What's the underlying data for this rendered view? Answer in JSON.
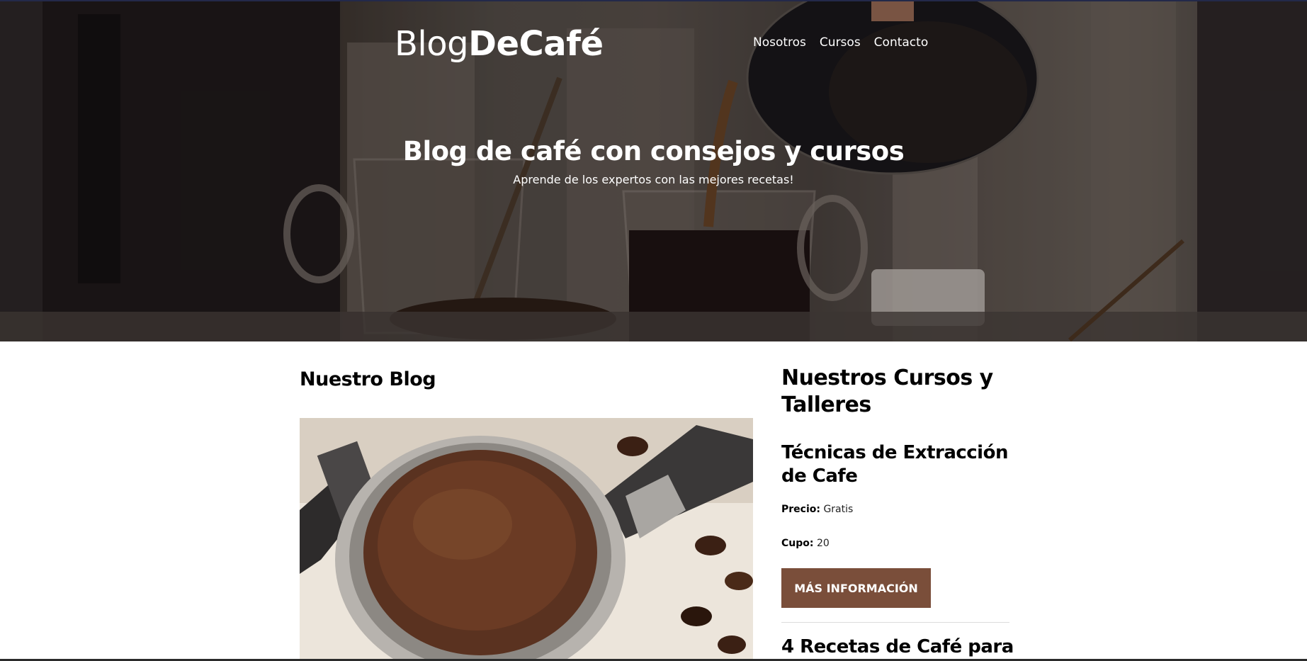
{
  "header": {
    "logo_light": "Blog",
    "logo_bold": "DeCafé",
    "nav": [
      "Nosotros",
      "Cursos",
      "Contacto"
    ]
  },
  "hero": {
    "title": "Blog de café con consejos y cursos",
    "subtitle": "Aprende de los expertos con las mejores recetas!"
  },
  "blog": {
    "title": "Nuestro Blog"
  },
  "courses": {
    "title": "Nuestros Cursos y Talleres",
    "items": [
      {
        "name": "Técnicas de Extracción de Cafe",
        "price_label": "Precio:",
        "price_value": "Gratis",
        "quota_label": "Cupo:",
        "quota_value": "20",
        "button": "Más Información"
      },
      {
        "name": "4 Recetas de Café para"
      }
    ]
  },
  "colors": {
    "button_bg": "#7a4e3a",
    "text": "#000000"
  }
}
